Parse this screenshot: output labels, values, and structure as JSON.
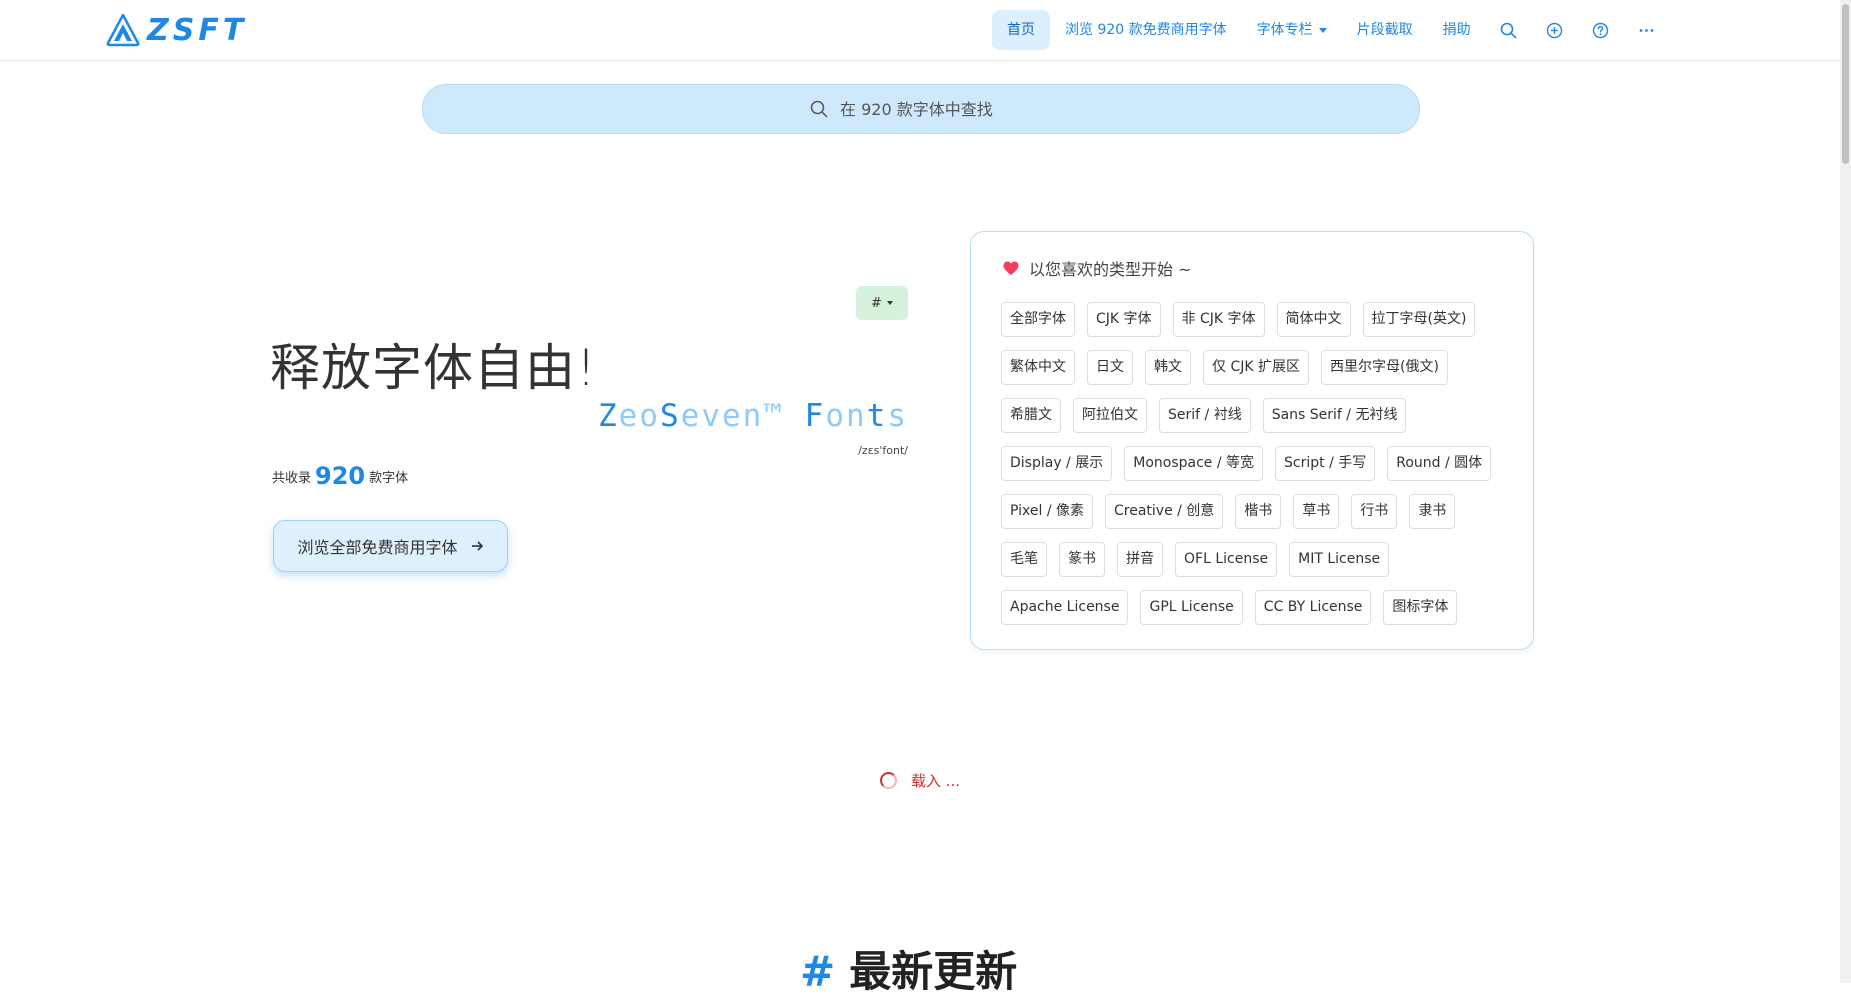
{
  "header": {
    "logo_text": "ZSFT",
    "nav": [
      {
        "label": "首页",
        "active": true
      },
      {
        "label": "浏览 920 款免费商用字体",
        "active": false
      },
      {
        "label": "字体专栏",
        "active": false,
        "has_dropdown": true
      },
      {
        "label": "片段截取",
        "active": false
      },
      {
        "label": "捐助",
        "active": false
      }
    ],
    "icons": [
      "search-icon",
      "plus-circle-icon",
      "help-circle-icon",
      "more-icon"
    ]
  },
  "search": {
    "placeholder": "在 920 款字体中查找"
  },
  "hero": {
    "badge": "#",
    "title": "释放字体自由!",
    "brand_main": "Zeo",
    "brand_parts": [
      "Z",
      "eo",
      "S",
      "even",
      "™ ",
      "F",
      "on",
      "t",
      "s"
    ],
    "brand_sub": "/zɛs'font/",
    "stat_prefix": "共收录",
    "stat_count": "920",
    "stat_suffix": "款字体",
    "cta_label": "浏览全部免费商用字体"
  },
  "categories": {
    "heading": "以您喜欢的类型开始 ~",
    "items": [
      "全部字体",
      "CJK 字体",
      "非 CJK 字体",
      "简体中文",
      "拉丁字母(英文)",
      "繁体中文",
      "日文",
      "韩文",
      "仅 CJK 扩展区",
      "西里尔字母(俄文)",
      "希腊文",
      "阿拉伯文",
      "Serif / 衬线",
      "Sans Serif / 无衬线",
      "Display / 展示",
      "Monospace / 等宽",
      "Script / 手写",
      "Round / 圆体",
      "Pixel / 像素",
      "Creative / 创意",
      "楷书",
      "草书",
      "行书",
      "隶书",
      "毛笔",
      "篆书",
      "拼音",
      "OFL License",
      "MIT License",
      "Apache License",
      "GPL License",
      "CC BY License",
      "图标字体"
    ]
  },
  "loading": {
    "text": "载入 ..."
  },
  "section": {
    "hash": "#",
    "title": "最新更新"
  },
  "colors": {
    "accent": "#1e88e5",
    "search_bg": "#cfe9fc",
    "nav_active_bg": "#dcefff",
    "badge_bg": "#d5f2dd",
    "loading": "#d32f2f"
  }
}
